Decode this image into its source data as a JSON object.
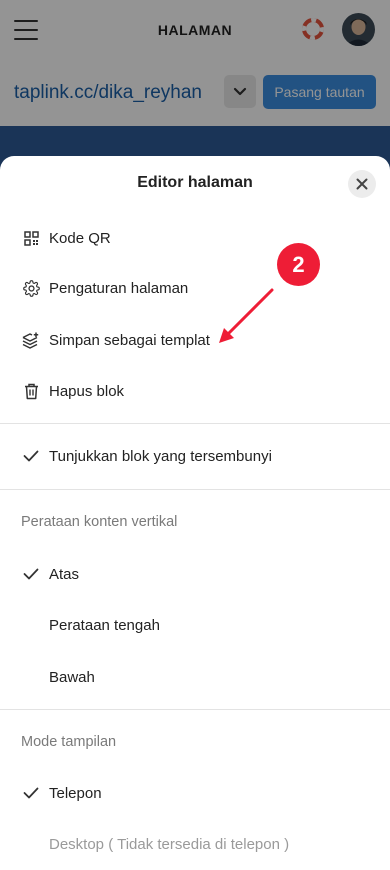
{
  "header": {
    "title": "HALAMAN"
  },
  "link_bar": {
    "url": "taplink.cc/dika_reyhan",
    "install_label": "Pasang tautan"
  },
  "sheet": {
    "title": "Editor halaman",
    "actions": [
      {
        "label": "Kode QR",
        "icon": "qr-code-icon"
      },
      {
        "label": "Pengaturan halaman",
        "icon": "gear-icon"
      },
      {
        "label": "Simpan sebagai templat",
        "icon": "layers-plus-icon"
      },
      {
        "label": "Hapus blok",
        "icon": "trash-icon"
      }
    ],
    "toggle": {
      "label": "Tunjukkan blok yang tersembunyi",
      "checked": true
    },
    "vertical_align": {
      "section_label": "Perataan konten vertikal",
      "options": [
        {
          "label": "Atas",
          "checked": true
        },
        {
          "label": "Perataan tengah",
          "checked": false
        },
        {
          "label": "Bawah",
          "checked": false
        }
      ]
    },
    "view_mode": {
      "section_label": "Mode tampilan",
      "options": [
        {
          "label": "Telepon",
          "checked": true
        },
        {
          "label": "Desktop ( Tidak tersedia di telepon )",
          "checked": false,
          "disabled": true
        }
      ]
    }
  },
  "annotation": {
    "badge": "2",
    "color": "#ee1d36"
  },
  "colors": {
    "accent": "#3b8ee0",
    "link": "#1a5fa8",
    "header_band": "#2d5a96"
  }
}
